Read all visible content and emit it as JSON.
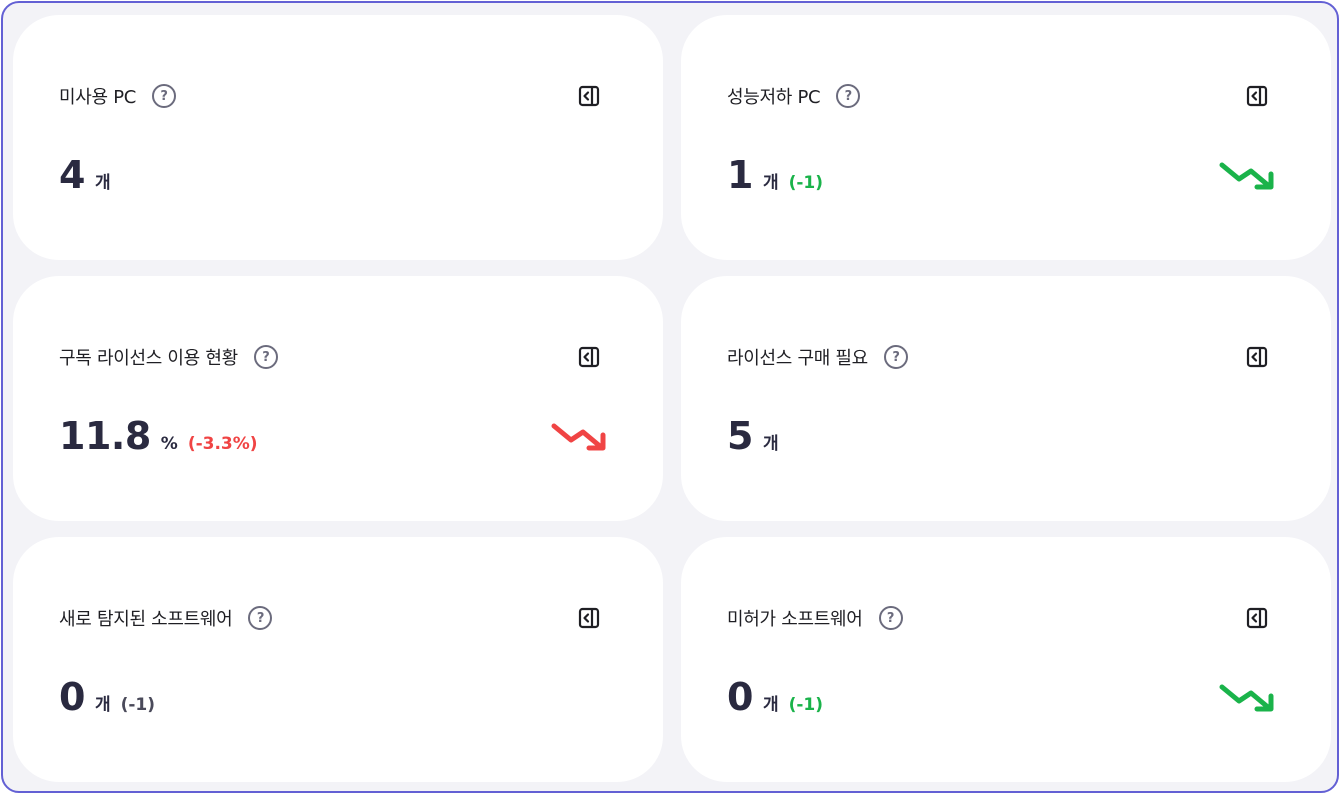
{
  "colors": {
    "frame_border": "#6360d4",
    "green": "#1ab34a",
    "red": "#f04444",
    "text_dark": "#2a2a40"
  },
  "cards": [
    {
      "title": "미사용 PC",
      "value": "4",
      "unit": "개",
      "delta": "",
      "delta_color": "",
      "trend": "none",
      "help_icon": "question-circle",
      "action_icon": "collapse-panel"
    },
    {
      "title": "성능저하 PC",
      "value": "1",
      "unit": "개",
      "delta": "(-1)",
      "delta_color": "green",
      "trend": "down-green",
      "help_icon": "question-circle",
      "action_icon": "collapse-panel"
    },
    {
      "title": "구독 라이선스 이용 현황",
      "value": "11.8",
      "unit": "%",
      "delta": "(-3.3%)",
      "delta_color": "red",
      "trend": "down-red",
      "help_icon": "question-circle",
      "action_icon": "collapse-panel"
    },
    {
      "title": "라이선스 구매 필요",
      "value": "5",
      "unit": "개",
      "delta": "",
      "delta_color": "",
      "trend": "none",
      "help_icon": "question-circle",
      "action_icon": "collapse-panel"
    },
    {
      "title": "새로 탐지된 소프트웨어",
      "value": "0",
      "unit": "개",
      "delta": "(-1)",
      "delta_color": "gray",
      "trend": "none",
      "help_icon": "question-circle",
      "action_icon": "collapse-panel"
    },
    {
      "title": "미허가 소프트웨어",
      "value": "0",
      "unit": "개",
      "delta": "(-1)",
      "delta_color": "green",
      "trend": "down-green",
      "help_icon": "question-circle",
      "action_icon": "collapse-panel"
    }
  ]
}
